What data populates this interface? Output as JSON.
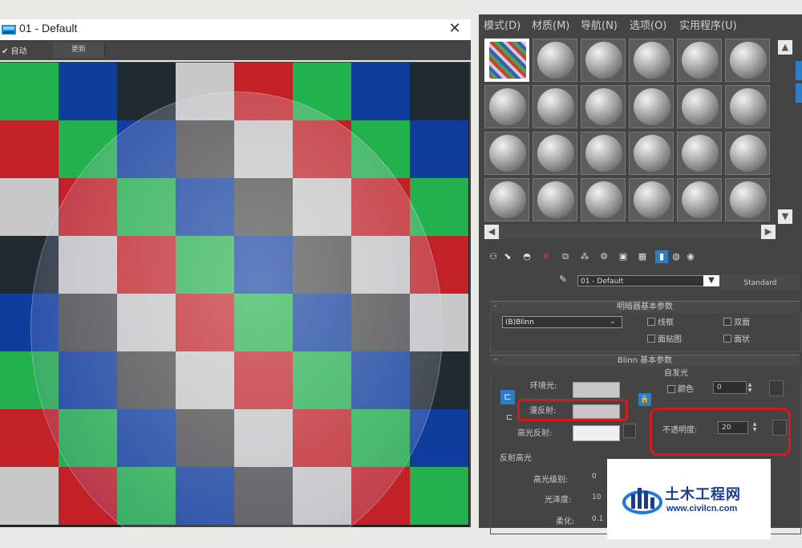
{
  "preview": {
    "title": "01 - Default",
    "close": "✕",
    "auto_label": "✔ 自动",
    "update_label": "更新"
  },
  "checker_colors": {
    "green": "#22b14c",
    "blue": "#0f3d9e",
    "red": "#c22127",
    "dark": "#1f2a31",
    "light": "#c8c8c8",
    "gray": "#4a4a4a"
  },
  "checker_rows": [
    [
      "green",
      "blue",
      "dark",
      "light",
      "red",
      "green",
      "blue",
      "dark"
    ],
    [
      "red",
      "green",
      "blue",
      "gray",
      "light",
      "red",
      "green",
      "blue"
    ],
    [
      "light",
      "red",
      "green",
      "blue",
      "gray",
      "light",
      "red",
      "green"
    ],
    [
      "dark",
      "light",
      "red",
      "green",
      "blue",
      "gray",
      "light",
      "red"
    ],
    [
      "blue",
      "gray",
      "light",
      "red",
      "green",
      "blue",
      "gray",
      "light"
    ],
    [
      "green",
      "blue",
      "gray",
      "light",
      "red",
      "green",
      "blue",
      "dark"
    ],
    [
      "red",
      "green",
      "blue",
      "gray",
      "light",
      "red",
      "green",
      "blue"
    ],
    [
      "light",
      "red",
      "green",
      "blue",
      "gray",
      "light",
      "red",
      "green"
    ]
  ],
  "editor": {
    "menus": [
      "模式(D)",
      "材质(M)",
      "导航(N)",
      "选项(O)",
      "实用程序(U)"
    ],
    "material_name": "01 - Default",
    "type_button": "Standard",
    "shader_rollout": "明暗器基本参数",
    "shader_value": "(B)Blinn",
    "checkboxes": {
      "wire": "线框",
      "two_sided": "双面",
      "face_map": "面贴图",
      "faceted": "面状"
    },
    "blinn_rollout": "Blinn 基本参数",
    "self_illum_group": "自发光",
    "color_label": "颜色",
    "self_illum_value": "0",
    "ambient_label": "环境光:",
    "diffuse_label": "漫反射:",
    "specular_label": "高光反射:",
    "opacity_label": "不透明度:",
    "opacity_value": "20",
    "spec_group": "反射高光",
    "spec_level_label": "高光级别:",
    "spec_level_value": "0",
    "gloss_label": "光泽度:",
    "gloss_value": "10",
    "soften_label": "柔化:",
    "soften_value": "0.1"
  },
  "watermark": {
    "title": "土木工程网",
    "url": "www.civilcn.com"
  }
}
